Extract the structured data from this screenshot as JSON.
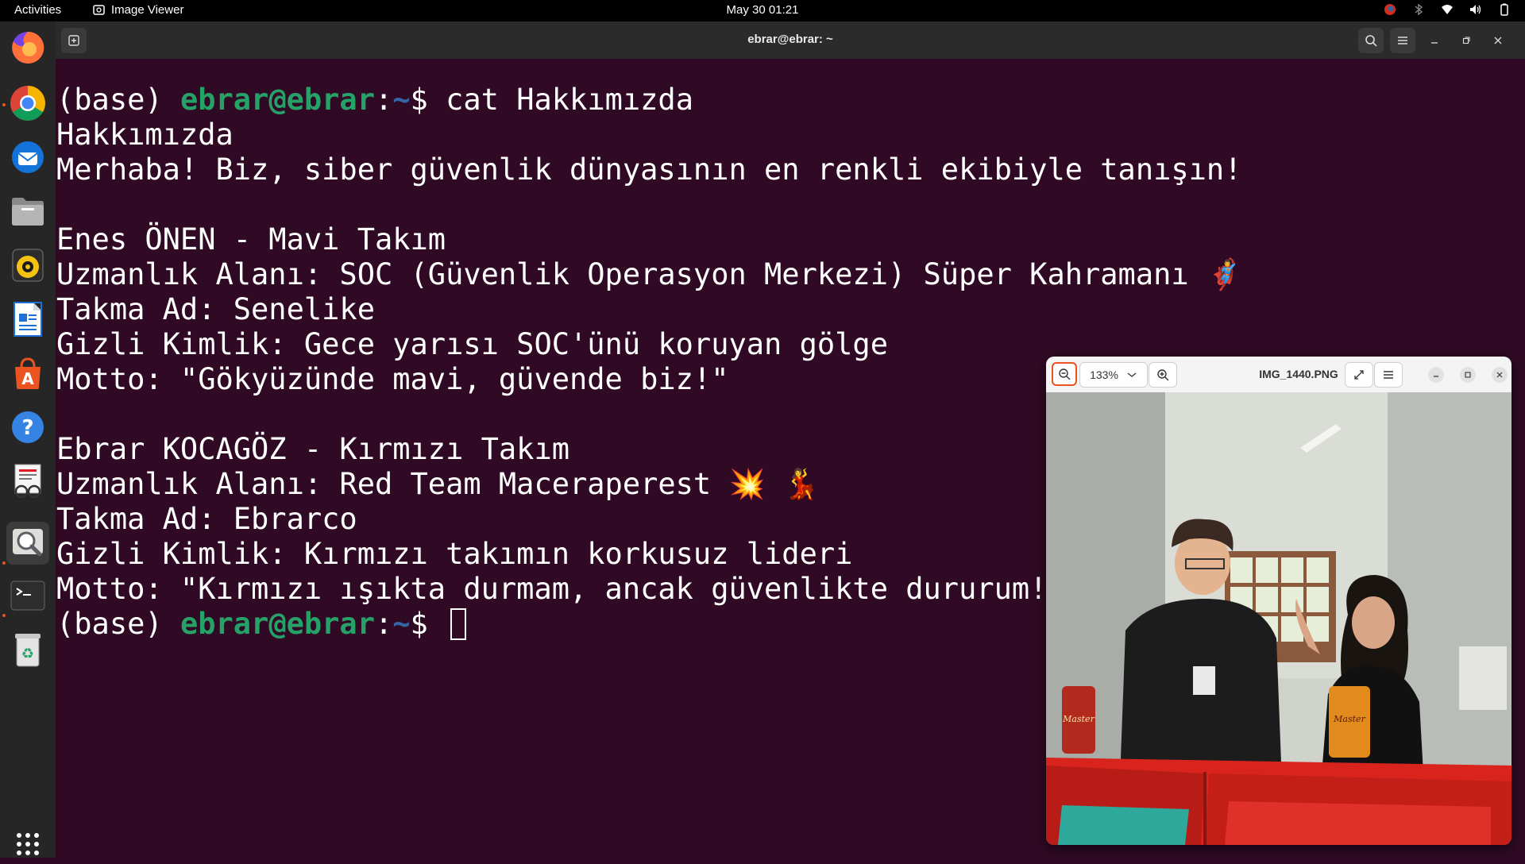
{
  "topbar": {
    "activities": "Activities",
    "app_name": "Image Viewer",
    "clock": "May 30  01:21"
  },
  "dock": {
    "items": [
      "firefox",
      "chrome",
      "thunderbird",
      "files",
      "rhythmbox",
      "writer",
      "app-center",
      "help",
      "document-viewer",
      "image-viewer",
      "terminal",
      "trash",
      "show-apps"
    ]
  },
  "terminal": {
    "title": "ebrar@ebrar: ~",
    "prompt_env": "(base) ",
    "prompt_user": "ebrar@ebrar",
    "prompt_colon": ":",
    "prompt_path": "~",
    "prompt_dollar": "$ ",
    "command": "cat Hakkımızda",
    "lines": [
      "Hakkımızda",
      "Merhaba! Biz, siber güvenlik dünyasının en renkli ekibiyle tanışın!",
      "",
      "Enes ÖNEN - Mavi Takım",
      "Uzmanlık Alanı: SOC (Güvenlik Operasyon Merkezi) Süper Kahramanı 🦸‍♂️",
      "Takma Ad: Senelike",
      "Gizli Kimlik: Gece yarısı SOC'ünü koruyan gölge",
      "Motto: \"Gökyüzünde mavi, güvende biz!\"",
      "",
      "Ebrar KOCAGÖZ - Kırmızı Takım",
      "Uzmanlık Alanı: Red Team Maceraperest 💥 💃",
      "Takma Ad: Ebrarco",
      "Gizli Kimlik: Kırmızı takımın korkusuz lideri",
      "Motto: \"Kırmızı ışıkta durmam, ancak güvenlikte dururum!\""
    ]
  },
  "viewer": {
    "zoom": "133%",
    "filename": "IMG_1440.PNG"
  },
  "colors": {
    "terminal_bg": "#300a24",
    "prompt_green": "#26a269",
    "prompt_blue": "#3465a4",
    "accent_orange": "#e95420"
  }
}
